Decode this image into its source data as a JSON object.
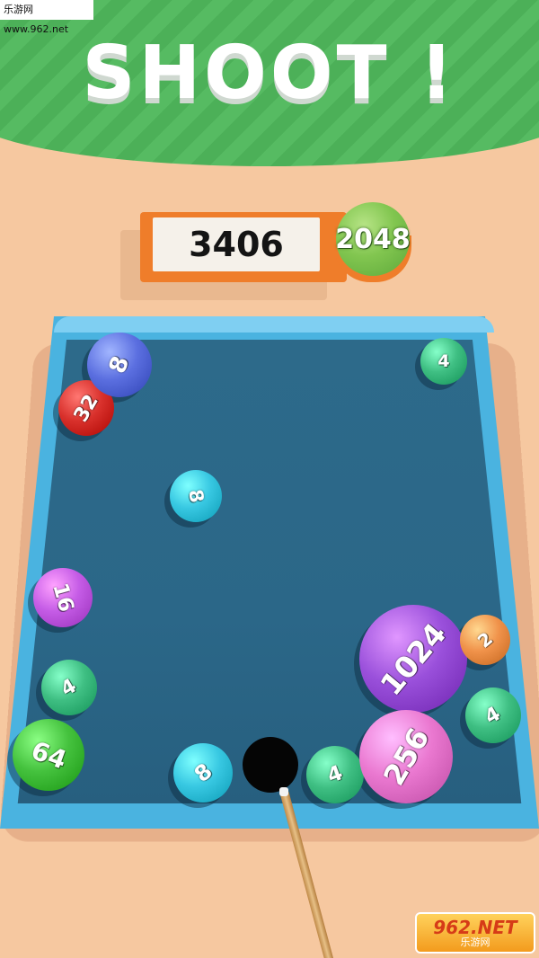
{
  "watermark_top": "乐游网 www.962.net",
  "header": {
    "title": "SHOOT !"
  },
  "score": {
    "value": "3406",
    "goal_label": "2048"
  },
  "balls": [
    {
      "label": "32",
      "color": "#d9312c"
    },
    {
      "label": "8",
      "color": "#5b6fe0"
    },
    {
      "label": "4",
      "color": "#3fbf83"
    },
    {
      "label": "8",
      "color": "#38c8e2"
    },
    {
      "label": "16",
      "color": "#c55ce6"
    },
    {
      "label": "4",
      "color": "#3fbf83"
    },
    {
      "label": "64",
      "color": "#45c23e"
    },
    {
      "label": "8",
      "color": "#38c8e2"
    },
    {
      "label": "4",
      "color": "#3fbf83"
    },
    {
      "label": "1024",
      "color": "#9a50db"
    },
    {
      "label": "2",
      "color": "#f0924a"
    },
    {
      "label": "4",
      "color": "#3fbf83"
    },
    {
      "label": "256",
      "color": "#ea78d0"
    }
  ],
  "watermark_bottom": {
    "main": "962.NET",
    "sub": "乐游网"
  }
}
